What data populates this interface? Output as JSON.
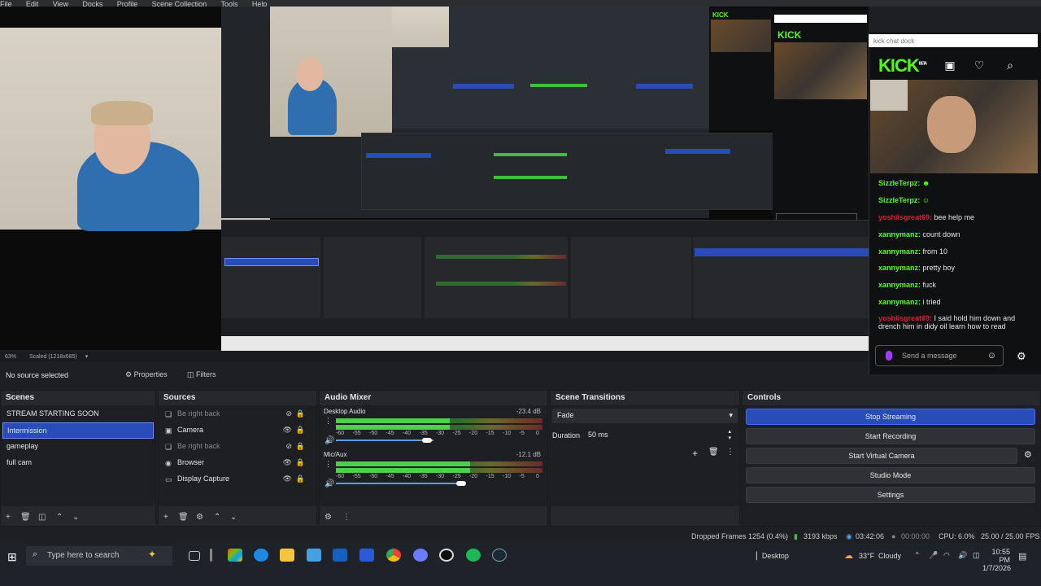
{
  "menu": [
    "File",
    "Edit",
    "View",
    "Docks",
    "Profile",
    "Scene Collection",
    "Tools",
    "Help"
  ],
  "preview": {
    "zoom": "63%",
    "scale": "Scaled (1218x685)"
  },
  "chat": {
    "dock_title": "kick chat dock",
    "logo": "KICK",
    "logo_sup": "BETA",
    "messages": [
      {
        "user": "SizzleTerpz:",
        "text": "",
        "color": "#53fc18"
      },
      {
        "user": "SizzleTerpz:",
        "text": "",
        "color": "#53fc18"
      },
      {
        "user": "yoshiisgreat69:",
        "text": " bee help me",
        "color": "#e0183a"
      },
      {
        "user": "xannymanz:",
        "text": " count down",
        "color": "#53fc18"
      },
      {
        "user": "xannymanz:",
        "text": " from 10",
        "color": "#53fc18"
      },
      {
        "user": "xannymanz:",
        "text": " pretty boy",
        "color": "#53fc18"
      },
      {
        "user": "xannymanz:",
        "text": " fuck",
        "color": "#53fc18"
      },
      {
        "user": "xannymanz:",
        "text": " i tried",
        "color": "#53fc18"
      },
      {
        "user": "yoshiisgreat69:",
        "text": " I said hold him down and drench him in didy oil learn how to read",
        "color": "#e0183a"
      }
    ],
    "send_placeholder": "Send a message"
  },
  "properties_bar": {
    "no_source": "No source selected",
    "properties": "Properties",
    "filters": "Filters"
  },
  "scenes": {
    "title": "Scenes",
    "items": [
      "STREAM STARTING SOON",
      "Intermission",
      "gameplay",
      "full cam"
    ],
    "selected_index": 1
  },
  "sources": {
    "title": "Sources",
    "items": [
      {
        "label": "Be right back",
        "hidden": true
      },
      {
        "label": "Camera",
        "hidden": false
      },
      {
        "label": "Be right back",
        "hidden": true
      },
      {
        "label": "Browser",
        "hidden": false
      },
      {
        "label": "Display Capture",
        "hidden": false
      }
    ]
  },
  "mixer": {
    "title": "Audio Mixer",
    "channels": [
      {
        "name": "Desktop Audio",
        "db": "-23.4 dB",
        "level": 0.55
      },
      {
        "name": "Mic/Aux",
        "db": "-12.1 dB",
        "level": 0.65
      }
    ],
    "scale": [
      "-60",
      "-55",
      "-50",
      "-45",
      "-40",
      "-35",
      "-30",
      "-25",
      "-20",
      "-15",
      "-10",
      "-5",
      "0"
    ]
  },
  "transitions": {
    "title": "Scene Transitions",
    "selected": "Fade",
    "duration_label": "Duration",
    "duration_value": "50 ms"
  },
  "controls": {
    "title": "Controls",
    "buttons": [
      "Stop Streaming",
      "Start Recording",
      "Start Virtual Camera",
      "Studio Mode",
      "Settings"
    ]
  },
  "status": {
    "dropped": "Dropped Frames 1254 (0.4%)",
    "bitrate": "3193 kbps",
    "stream_time": "03:42:06",
    "rec_time": "00:00:00",
    "cpu": "CPU: 6.0%",
    "fps": "25.00 / 25.00 FPS"
  },
  "taskbar": {
    "search_placeholder": "Type here to search",
    "desktop": "Desktop",
    "weather_temp": "33°F",
    "weather_text": "Cloudy",
    "time": "10:55 PM",
    "date": "1/7/2026"
  }
}
